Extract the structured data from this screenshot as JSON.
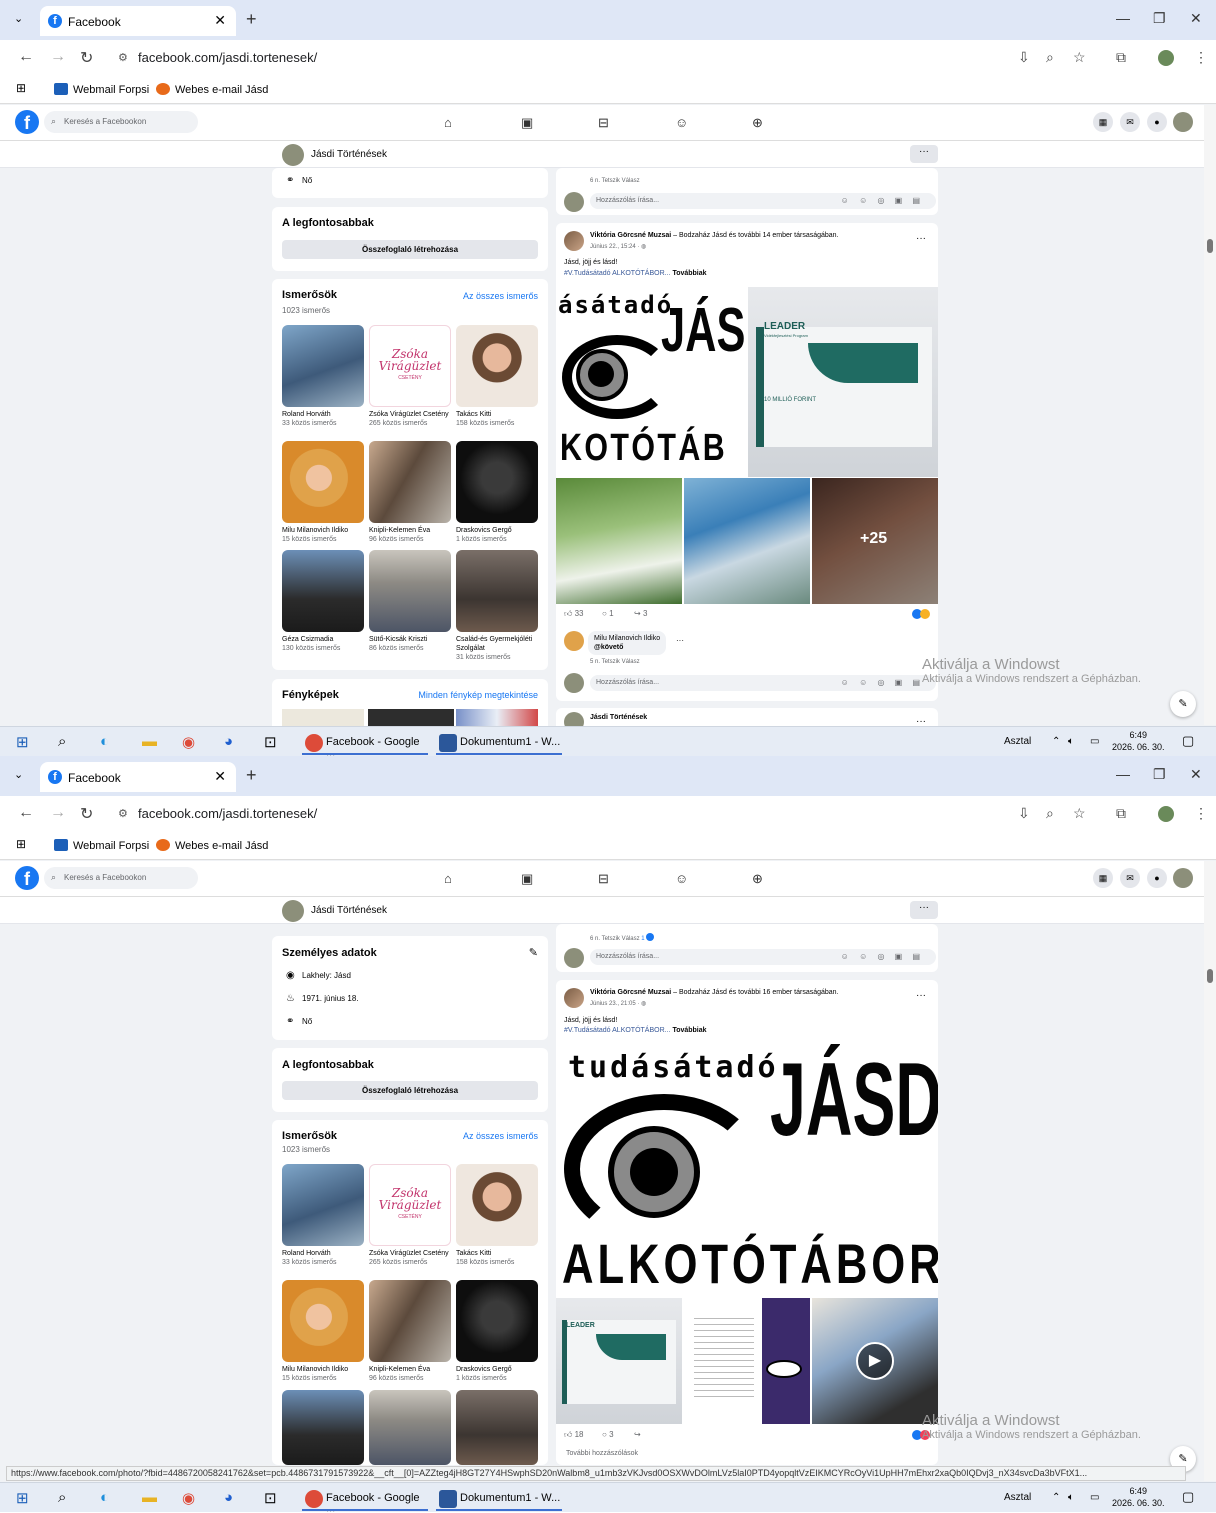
{
  "browser": {
    "tab_title": "Facebook",
    "url": "facebook.com/jasdi.tortenesek/",
    "bookmarks": [
      "Webmail Forpsi",
      "Webes e-mail Jásd"
    ]
  },
  "facebook": {
    "search_placeholder": "Keresés a Facebookon",
    "page_name": "Jásdi Történések",
    "more": "···"
  },
  "about": {
    "title": "Személyes adatok",
    "residence": "Lakhely: Jásd",
    "birthday": "1971. június 18.",
    "gender": "Nő"
  },
  "featured": {
    "title": "A legfontosabbak",
    "button": "Összefoglaló létrehozása"
  },
  "friends": {
    "title": "Ismerősök",
    "count": "1023 ismerős",
    "all_link": "Az összes ismerős",
    "items": [
      {
        "name": "Roland Horváth",
        "mutual": "33 közös ismerős"
      },
      {
        "name": "Zsóka Virágüzlet Csetény",
        "mutual": "265 közös ismerős"
      },
      {
        "name": "Takács Kitti",
        "mutual": "158 közös ismerős"
      },
      {
        "name": "Milu Milanovich Ildiko",
        "mutual": "15 közös ismerős"
      },
      {
        "name": "Knipli-Kelemen Éva",
        "mutual": "96 közös ismerős"
      },
      {
        "name": "Draskovics Gergő",
        "mutual": "1 közös ismerős"
      },
      {
        "name": "Géza Csizmadia",
        "mutual": "130 közös ismerős"
      },
      {
        "name": "Sütő-Kicsák Kriszti",
        "mutual": "86 közös ismerős"
      },
      {
        "name": "Család-és Gyermekjóléti Szolgálat",
        "mutual": "31 közös ismerős"
      }
    ],
    "zsoka_logo": "Zsóka Virágüzlet",
    "zsoka_sub": "CSETÉNY"
  },
  "photos": {
    "title": "Fényképek",
    "all_link": "Minden fénykép megtekintése"
  },
  "comment": {
    "meta1": "6 n.   Tetszik   Válasz",
    "meta2_s2": "6 n.   Tetszik   Válasz",
    "reaction_count_s2": "1",
    "placeholder": "Hozzászólás írása...",
    "icons": "☺ ☺ ◎ ▣ ▤"
  },
  "post1": {
    "author": "Viktória Görcsné Muzsai",
    "with": " – Bodzaház Jásd és további 14 ember társaságában.",
    "time": "Június 22., 15:24 · ",
    "text": "Jásd, jöjj és lásd!",
    "hashtag": "#V.Tudásátadó ALKOTÓTÁBOR...",
    "more": "Továbbiak",
    "likes": "33",
    "comments": "1",
    "shares": "3",
    "more_photos": "+25",
    "commenter": "Milu Milanovich Ildiko",
    "commenter_tag": "@követő",
    "comment_meta": "5 n.   Tetszik   Válasz",
    "poster_word1": "ásátadó",
    "poster_word2": "JÁS",
    "poster_word3": "KOTÓTÁB",
    "leader": "LEADER",
    "leader_sub": "Vidékfejlesztési Program",
    "forint": "10 MILLIÓ FORINT"
  },
  "post2": {
    "author": "Viktória Görcsné Muzsai",
    "with": " – Bodzaház Jásd és további 16 ember társaságában.",
    "time": "Június 23., 21:05 · ",
    "text": "Jásd, jöjj és lásd!",
    "hashtag": "#V.Tudásátadó ALKOTÓTÁBOR...",
    "more": "Továbbiak",
    "likes": "18",
    "comments": "3",
    "more_comments": "További hozzászólások",
    "poster_top": "tudásátadó",
    "poster_jasd": "JÁSD",
    "poster_bottom": "ALKOTÓTÁBOR",
    "leader": "LEADER"
  },
  "next_post_author": "Jásdi Történések",
  "watermark": {
    "line1": "Aktiválja a Windowst",
    "line2": "Aktiválja a Windows rendszert a Gépházban."
  },
  "taskbar": {
    "app1": "Facebook - Google ...",
    "app2": "Dokumentum1 - W...",
    "desktop": "Asztal",
    "time": "6:49",
    "date": "2026. 06. 30."
  },
  "status_url": "https://www.facebook.com/photo/?fbid=4486720058241762&set=pcb.4486731791573922&__cft__[0]=AZZteg4jH8GT27Y4HSwphSD20nWalbm8_u1mb3zVKJvsd0OSXWvDOlmLVz5laI0PTD4yopqltVzEIKMCYRcOyVi1UpHH7mEhxr2xaQb0IQDvj3_nX34svcDa3bVFtX1...",
  "colors": {
    "fb_blue": "#1877f2",
    "bg": "#f0f2f5"
  }
}
